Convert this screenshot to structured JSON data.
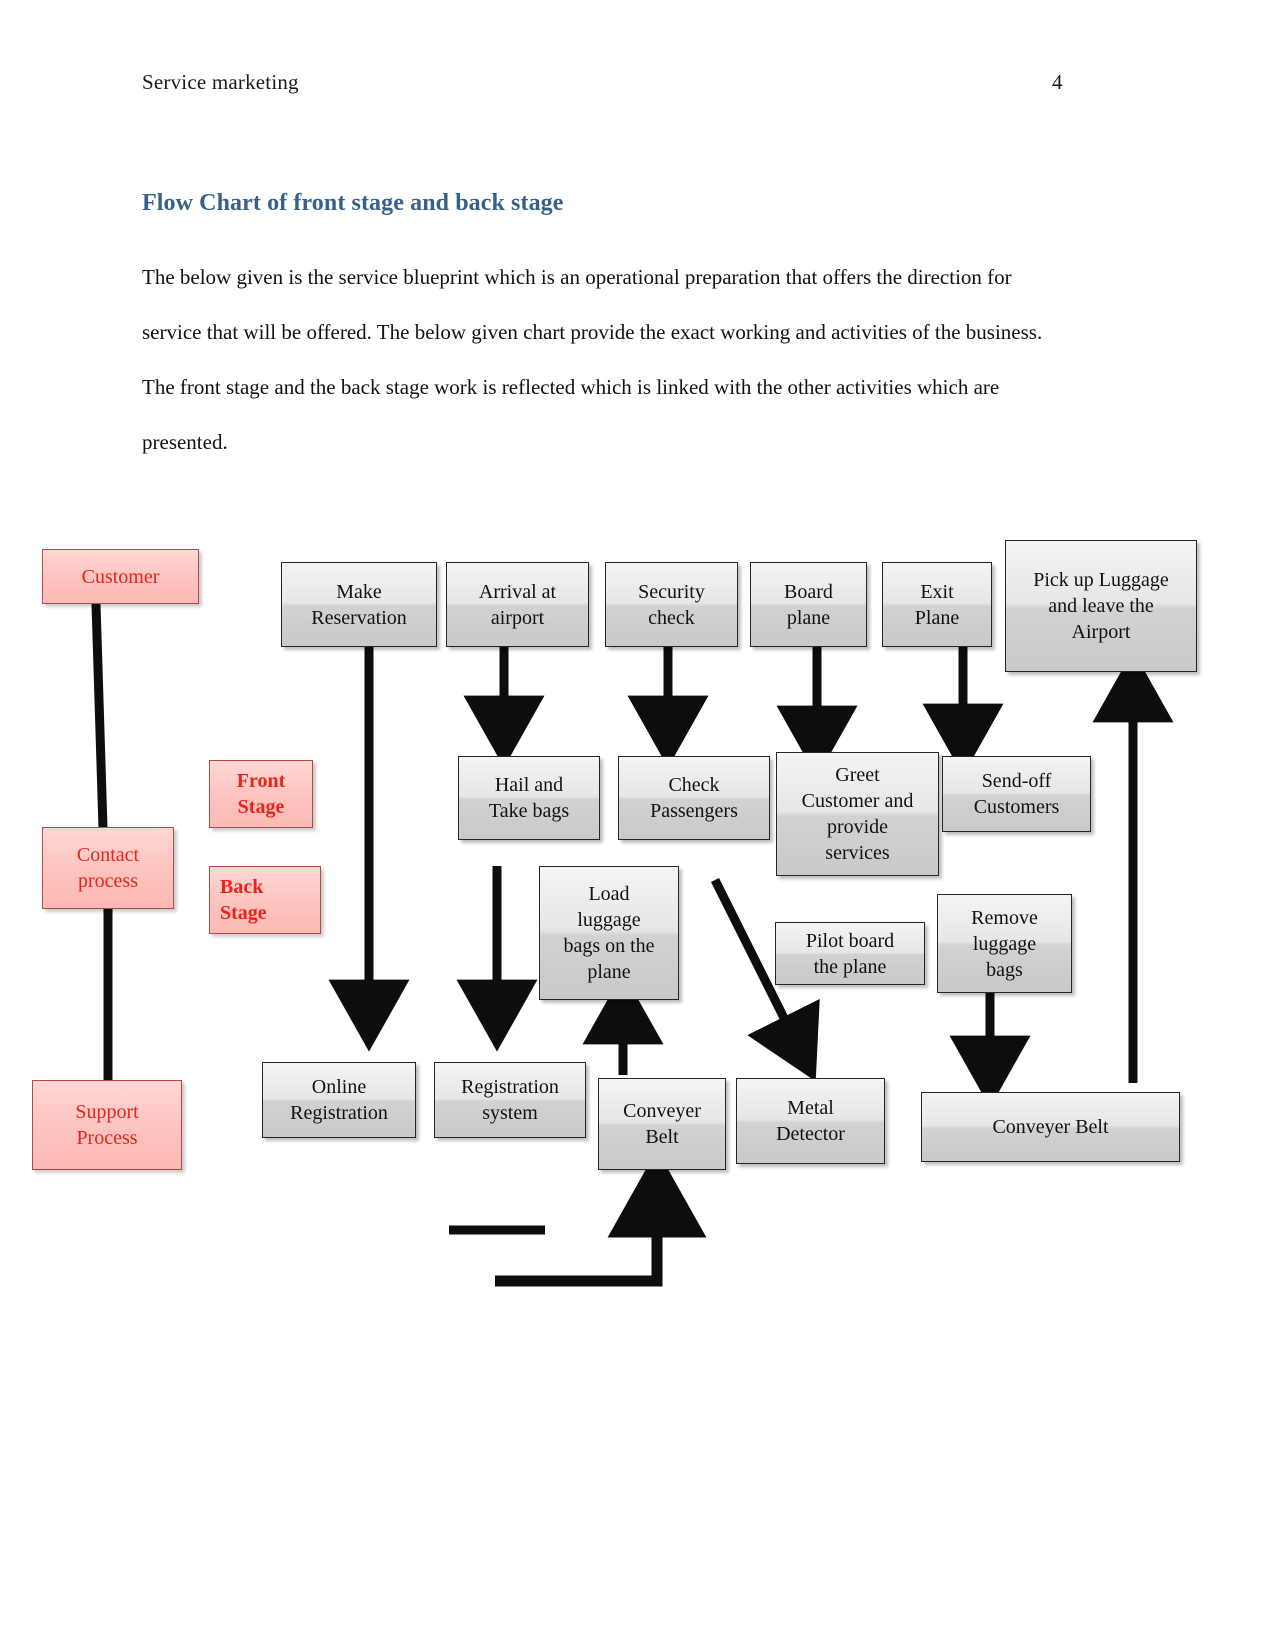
{
  "header": {
    "left_text": "Service marketing",
    "page_number": "4"
  },
  "heading": "Flow Chart of front stage and back stage",
  "paragraph": "The below given is the service blueprint which is an operational preparation that offers the direction for service that will be offered. The below given chart provide the exact working and activities of the business. The front stage and the back stage work is reflected which is linked with the other activities which are presented.",
  "colors": {
    "heading_blue": "#36618d",
    "pink_fill": "#fdc3bf",
    "pink_border": "#b04a45",
    "pink_text": "#e8241b",
    "gray_fill": "#e2e2e2",
    "gray_border": "#262626",
    "connector": "#0d0d0d"
  },
  "diagram": {
    "title": "Service blueprint flow chart",
    "swimlane_labels": [
      {
        "id": "customer",
        "label": "Customer"
      },
      {
        "id": "contact-process",
        "label": "Contact\nprocess"
      },
      {
        "id": "support-process",
        "label": "Support\nProcess"
      },
      {
        "id": "front-stage",
        "label": "Front\nStage"
      },
      {
        "id": "back-stage",
        "label": "Back\nStage"
      }
    ],
    "nodes": [
      {
        "id": "make-reservation",
        "label": "Make\nReservation"
      },
      {
        "id": "arrival-at-airport",
        "label": "Arrival at\nairport"
      },
      {
        "id": "security-check",
        "label": "Security\ncheck"
      },
      {
        "id": "board-plane",
        "label": "Board\nplane"
      },
      {
        "id": "exit-plane",
        "label": "Exit\nPlane"
      },
      {
        "id": "pick-up-luggage",
        "label": "Pick up Luggage\nand leave the\nAirport"
      },
      {
        "id": "hail-and-take-bags",
        "label": "Hail and\nTake bags"
      },
      {
        "id": "check-passengers",
        "label": "Check\nPassengers"
      },
      {
        "id": "greet-customer",
        "label": "Greet\nCustomer and\nprovide\nservices"
      },
      {
        "id": "send-off-customers",
        "label": "Send-off\nCustomers"
      },
      {
        "id": "load-luggage",
        "label": "Load\nluggage\nbags on the\nplane"
      },
      {
        "id": "pilot-board",
        "label": "Pilot board\nthe plane"
      },
      {
        "id": "remove-luggage",
        "label": "Remove\nluggage\nbags"
      },
      {
        "id": "online-registration",
        "label": "Online\nRegistration"
      },
      {
        "id": "registration-system",
        "label": "Registration\nsystem"
      },
      {
        "id": "conveyer-belt-left",
        "label": "Conveyer\nBelt"
      },
      {
        "id": "metal-detector",
        "label": "Metal\nDetector"
      },
      {
        "id": "conveyer-belt-right",
        "label": "Conveyer Belt"
      }
    ],
    "connectors": [
      {
        "from": "customer",
        "to": "contact-process",
        "type": "line-down"
      },
      {
        "from": "contact-process",
        "to": "support-process",
        "type": "line-down"
      },
      {
        "from": "make-reservation",
        "to": "online-registration",
        "type": "arrow-down"
      },
      {
        "from": "arrival-at-airport",
        "to": "hail-and-take-bags",
        "type": "arrow-down"
      },
      {
        "from": "security-check",
        "to": "check-passengers",
        "type": "arrow-down"
      },
      {
        "from": "board-plane",
        "to": "greet-customer",
        "type": "arrow-down"
      },
      {
        "from": "exit-plane",
        "to": "send-off-customers",
        "type": "arrow-down"
      },
      {
        "from": "hail-and-take-bags",
        "to": "registration-system",
        "type": "arrow-down"
      },
      {
        "from": "greet-customer",
        "to": "metal-detector",
        "type": "arrow-diagonal"
      },
      {
        "from": "remove-luggage",
        "to": "conveyer-belt-right",
        "type": "arrow-down"
      },
      {
        "from": "conveyer-belt-left",
        "to": "load-luggage",
        "type": "arrow-up"
      },
      {
        "from": "conveyer-belt-right",
        "to": "pick-up-luggage",
        "type": "arrow-up"
      },
      {
        "from": "support-lane",
        "to": "conveyer-belt-left",
        "type": "elbow-arrow-up"
      }
    ]
  }
}
